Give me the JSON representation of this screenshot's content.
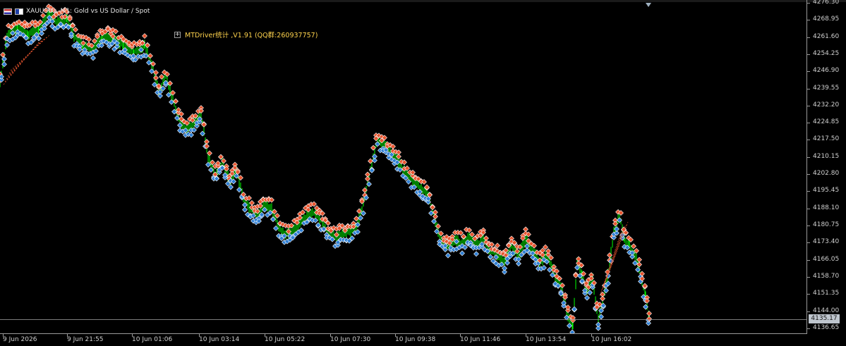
{
  "header": {
    "symbol": "XAUUSDs, M1:  Gold vs US Dollar / Spot"
  },
  "indicator": {
    "label": "MTDriver统计 ,V1.91 (QQ群:260937757)"
  },
  "current_price": "4135.17",
  "colors": {
    "background": "#000000",
    "bull_candle": "#00ff00",
    "buy_marker": "#2f7fd4",
    "sell_marker": "#e8552f",
    "grid": "#9a9a9a"
  },
  "chart_data": {
    "type": "line",
    "series": [],
    "y_ticks": [
      "4276.30",
      "4268.95",
      "4261.60",
      "4254.25",
      "4246.90",
      "4239.55",
      "4232.20",
      "4224.85",
      "4217.50",
      "4210.15",
      "4202.80",
      "4195.45",
      "4188.10",
      "4180.75",
      "4173.40",
      "4166.05",
      "4158.70",
      "4151.35",
      "4144.00",
      "4136.65"
    ],
    "x_ticks": [
      "9 Jun 2026",
      "9 Jun 21:55",
      "10 Jun 01:06",
      "10 Jun 03:14",
      "10 Jun 05:22",
      "10 Jun 07:30",
      "10 Jun 09:38",
      "10 Jun 11:46",
      "10 Jun 13:54",
      "10 Jun 16:02"
    ],
    "ylim": [
      4134.5,
      4277.5
    ],
    "price_path": [
      [
        0,
        4242
      ],
      [
        10,
        4262
      ],
      [
        25,
        4266
      ],
      [
        40,
        4263
      ],
      [
        55,
        4265
      ],
      [
        70,
        4272
      ],
      [
        80,
        4268
      ],
      [
        95,
        4270
      ],
      [
        105,
        4262
      ],
      [
        118,
        4258
      ],
      [
        130,
        4256
      ],
      [
        145,
        4262
      ],
      [
        160,
        4261
      ],
      [
        175,
        4258
      ],
      [
        190,
        4255
      ],
      [
        205,
        4258
      ],
      [
        215,
        4250
      ],
      [
        225,
        4238
      ],
      [
        235,
        4245
      ],
      [
        245,
        4235
      ],
      [
        255,
        4225
      ],
      [
        265,
        4222
      ],
      [
        275,
        4225
      ],
      [
        285,
        4228
      ],
      [
        295,
        4210
      ],
      [
        305,
        4202
      ],
      [
        315,
        4208
      ],
      [
        325,
        4200
      ],
      [
        335,
        4205
      ],
      [
        345,
        4192
      ],
      [
        355,
        4188
      ],
      [
        365,
        4185
      ],
      [
        375,
        4190
      ],
      [
        385,
        4188
      ],
      [
        395,
        4180
      ],
      [
        405,
        4177
      ],
      [
        415,
        4178
      ],
      [
        425,
        4182
      ],
      [
        435,
        4185
      ],
      [
        445,
        4186
      ],
      [
        455,
        4183
      ],
      [
        465,
        4178
      ],
      [
        475,
        4176
      ],
      [
        485,
        4177
      ],
      [
        495,
        4178
      ],
      [
        505,
        4180
      ],
      [
        515,
        4190
      ],
      [
        525,
        4205
      ],
      [
        535,
        4218
      ],
      [
        545,
        4215
      ],
      [
        555,
        4212
      ],
      [
        565,
        4208
      ],
      [
        575,
        4203
      ],
      [
        585,
        4200
      ],
      [
        595,
        4197
      ],
      [
        605,
        4195
      ],
      [
        615,
        4185
      ],
      [
        625,
        4174
      ],
      [
        635,
        4172
      ],
      [
        645,
        4175
      ],
      [
        655,
        4173
      ],
      [
        665,
        4176
      ],
      [
        675,
        4172
      ],
      [
        685,
        4175
      ],
      [
        695,
        4170
      ],
      [
        705,
        4168
      ],
      [
        715,
        4165
      ],
      [
        725,
        4172
      ],
      [
        735,
        4168
      ],
      [
        745,
        4175
      ],
      [
        755,
        4170
      ],
      [
        765,
        4165
      ],
      [
        775,
        4168
      ],
      [
        785,
        4160
      ],
      [
        795,
        4155
      ],
      [
        805,
        4142
      ],
      [
        812,
        4138
      ],
      [
        818,
        4165
      ],
      [
        825,
        4160
      ],
      [
        832,
        4152
      ],
      [
        840,
        4158
      ],
      [
        848,
        4140
      ],
      [
        855,
        4150
      ],
      [
        862,
        4160
      ],
      [
        870,
        4178
      ],
      [
        878,
        4185
      ],
      [
        885,
        4175
      ],
      [
        892,
        4172
      ],
      [
        900,
        4168
      ],
      [
        908,
        4160
      ],
      [
        915,
        4150
      ],
      [
        920,
        4140
      ]
    ]
  }
}
